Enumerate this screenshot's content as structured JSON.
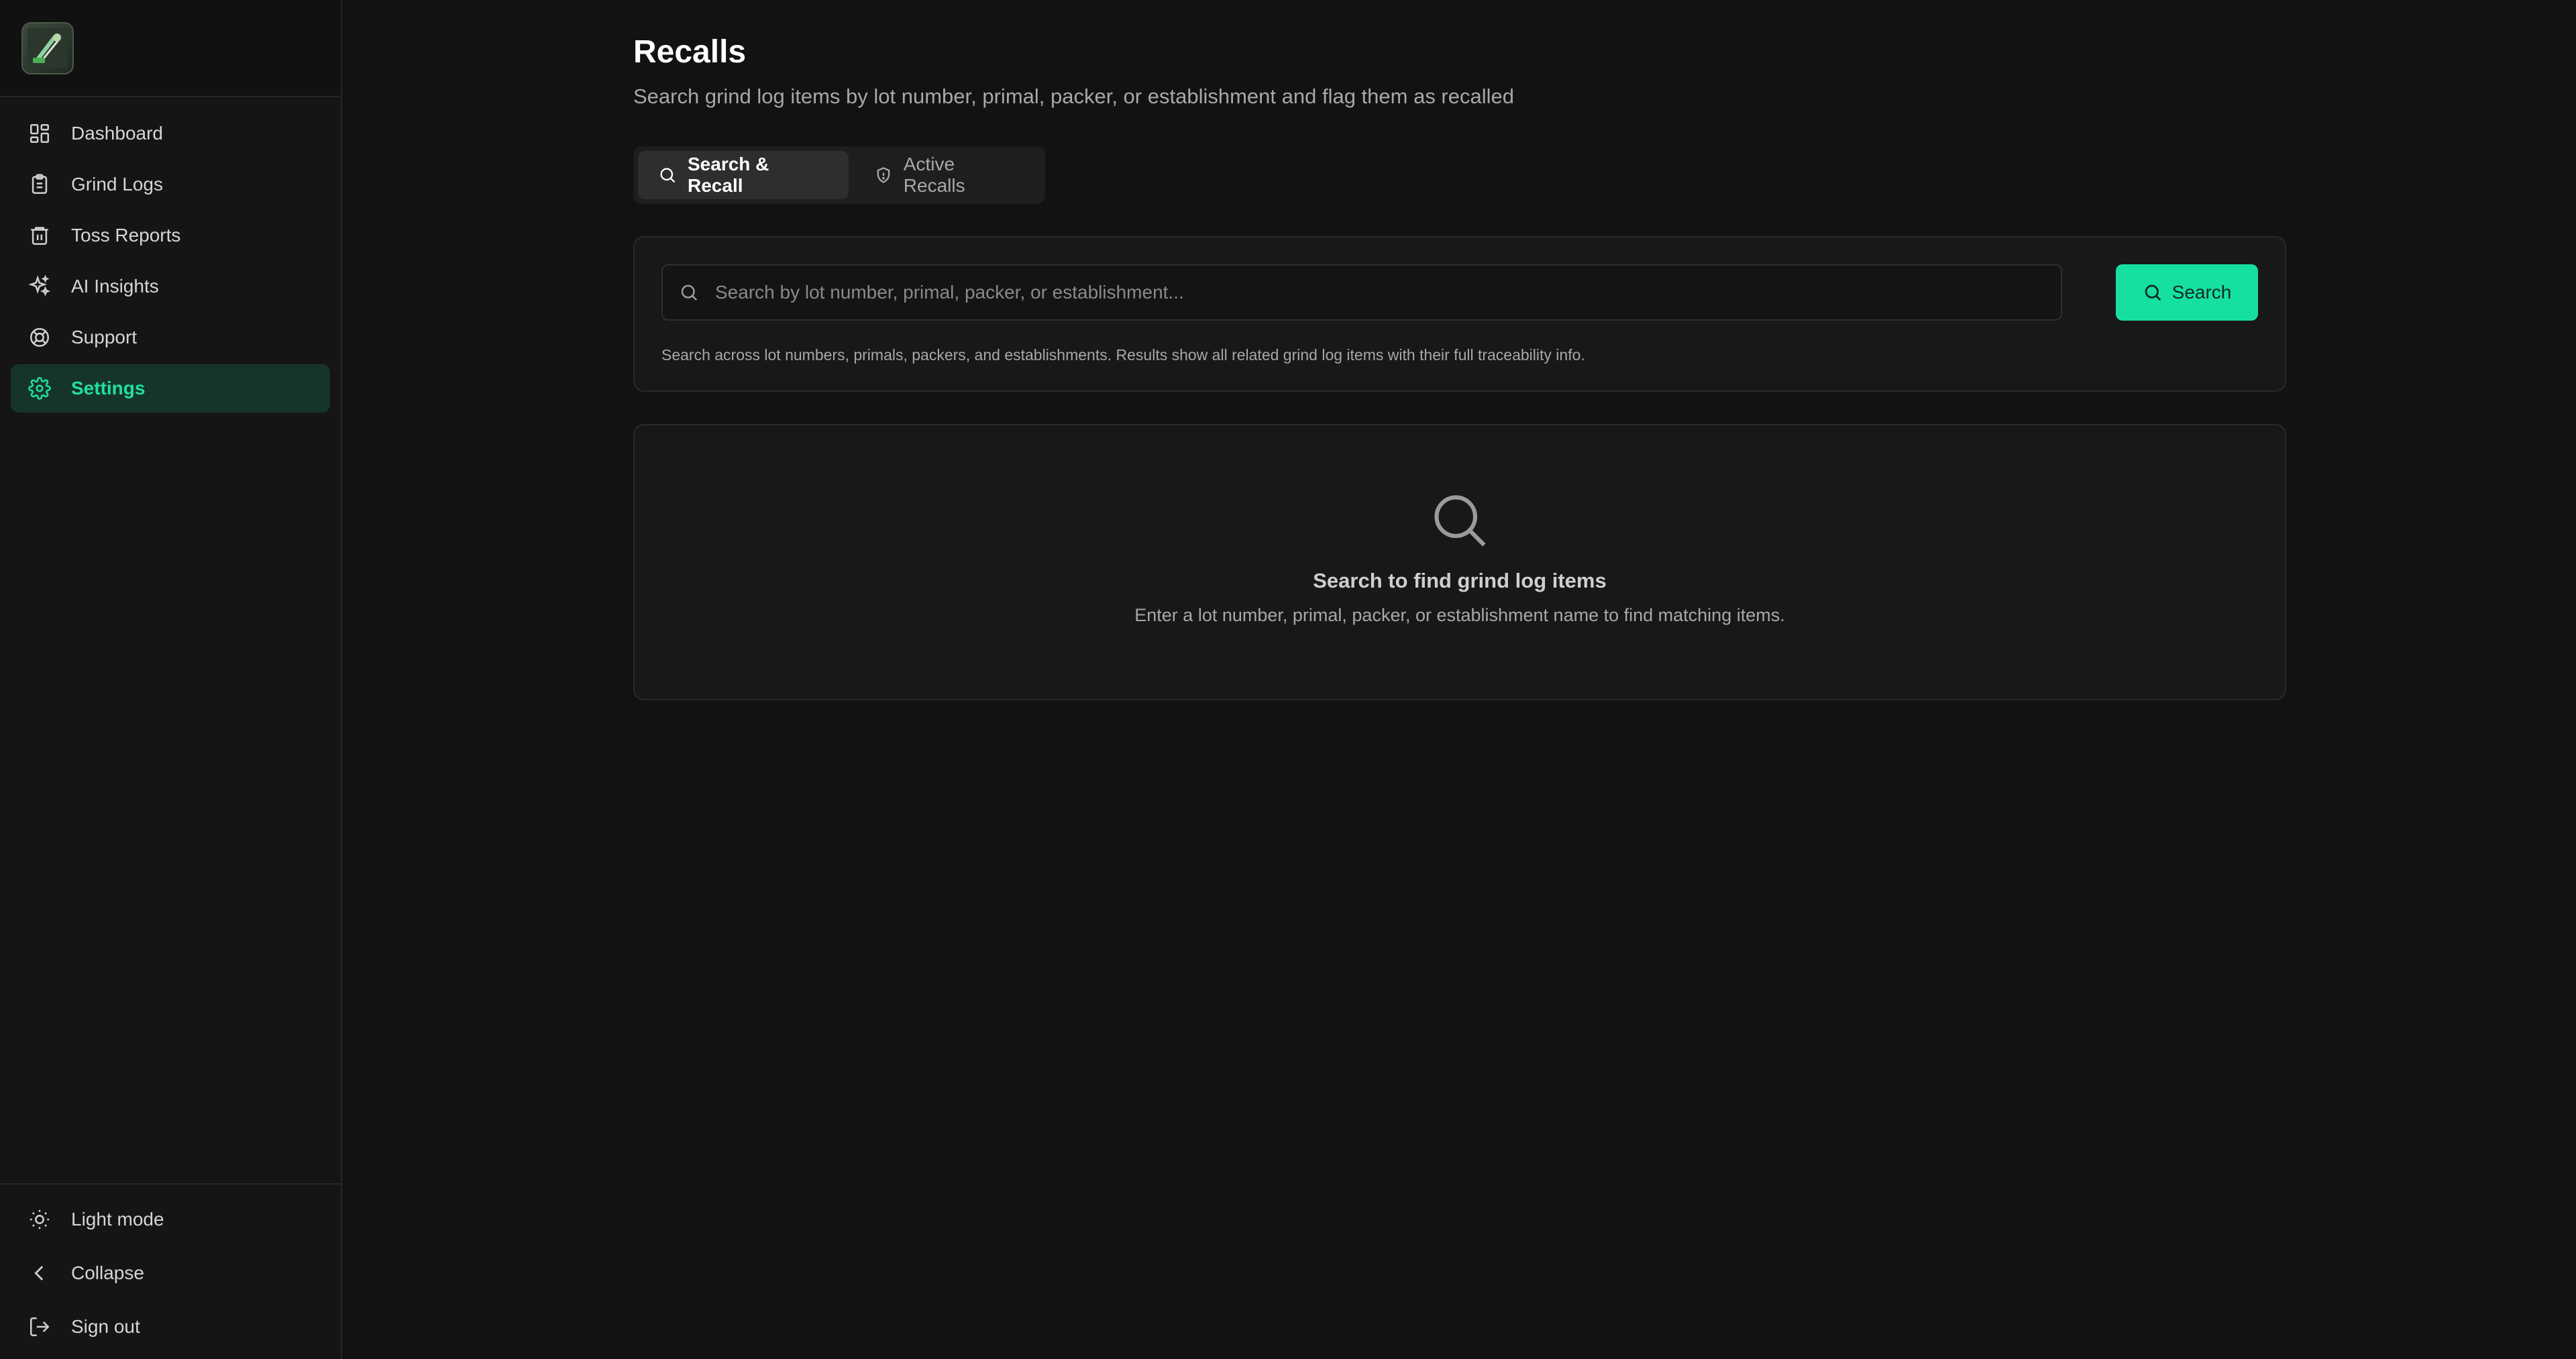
{
  "sidebar": {
    "items": [
      {
        "label": "Dashboard",
        "icon": "dashboard-icon"
      },
      {
        "label": "Grind Logs",
        "icon": "clipboard-icon"
      },
      {
        "label": "Toss Reports",
        "icon": "trash-icon"
      },
      {
        "label": "AI Insights",
        "icon": "sparkles-icon"
      },
      {
        "label": "Support",
        "icon": "lifebuoy-icon"
      },
      {
        "label": "Settings",
        "icon": "gear-icon",
        "active": true
      }
    ],
    "footer": [
      {
        "label": "Light mode",
        "icon": "sun-icon"
      },
      {
        "label": "Collapse",
        "icon": "chevron-left-icon"
      },
      {
        "label": "Sign out",
        "icon": "sign-out-icon"
      }
    ]
  },
  "main": {
    "title": "Recalls",
    "subtitle": "Search grind log items by lot number, primal, packer, or establishment and flag them as recalled",
    "tabs": [
      {
        "label": "Search & Recall",
        "icon": "search-icon",
        "active": true
      },
      {
        "label": "Active Recalls",
        "icon": "shield-icon",
        "active": false
      }
    ],
    "search": {
      "placeholder": "Search by lot number, primal, packer, or establishment...",
      "value": "",
      "button_label": "Search",
      "help_text": "Search across lot numbers, primals, packers, and establishments. Results show all related grind log items with their full traceability info."
    },
    "empty_state": {
      "title": "Search to find grind log items",
      "description": "Enter a lot number, primal, packer, or establishment name to find matching items."
    }
  },
  "colors": {
    "accent": "#16e0a0",
    "background": "#121212",
    "sidebar_active_bg": "#16352a"
  }
}
